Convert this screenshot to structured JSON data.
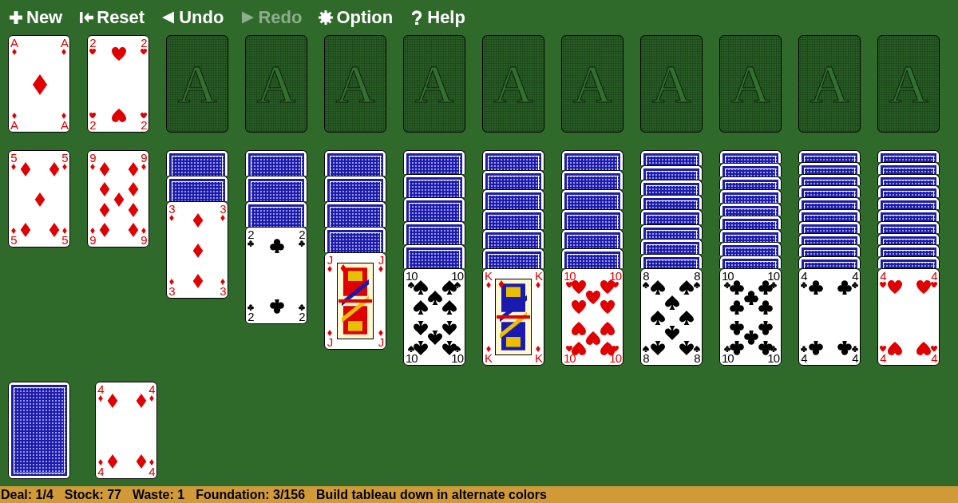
{
  "toolbar": [
    {
      "kind": "new",
      "label": "New",
      "disabled": false
    },
    {
      "kind": "reset",
      "label": "Reset",
      "disabled": false
    },
    {
      "kind": "undo",
      "label": "Undo",
      "disabled": false
    },
    {
      "kind": "redo",
      "label": "Redo",
      "disabled": true
    },
    {
      "kind": "option",
      "label": "Option",
      "disabled": false
    },
    {
      "kind": "help",
      "label": "Help",
      "disabled": false
    }
  ],
  "foundations": [
    {
      "kind": "card",
      "suit": {
        "kind": "diamonds"
      },
      "pips": {
        "kind": "ace"
      },
      "indices": [
        "A",
        "A",
        "A",
        "A"
      ]
    },
    {
      "kind": "card",
      "suit": {
        "kind": "hearts"
      },
      "pips": {
        "kind": "two"
      },
      "indices": [
        "2",
        "2",
        "2",
        "2"
      ]
    },
    {
      "kind": "empty",
      "label": "A"
    },
    {
      "kind": "empty",
      "label": "A"
    },
    {
      "kind": "empty",
      "label": "A"
    },
    {
      "kind": "empty",
      "label": "A"
    },
    {
      "kind": "empty",
      "label": "A"
    },
    {
      "kind": "empty",
      "label": "A"
    },
    {
      "kind": "empty",
      "label": "A"
    },
    {
      "kind": "empty",
      "label": "A"
    },
    {
      "kind": "empty",
      "label": "A"
    },
    {
      "kind": "empty",
      "label": "A"
    }
  ],
  "tableau": [
    {
      "cards": [
        {
          "face_up": true,
          "suit": {
            "kind": "diamonds"
          },
          "pips": {
            "kind": "five"
          },
          "indices": [
            "5",
            "5",
            "5",
            "5"
          ]
        }
      ]
    },
    {
      "cards": [
        {
          "face_up": true,
          "suit": {
            "kind": "diamonds"
          },
          "pips": {
            "kind": "nine"
          },
          "indices": [
            "9",
            "9",
            "9",
            "9"
          ]
        }
      ]
    },
    {
      "cards": [
        {
          "face_up": false
        },
        {
          "face_up": false
        },
        {
          "face_up": true,
          "suit": {
            "kind": "diamonds"
          },
          "pips": {
            "kind": "three"
          },
          "indices": [
            "3",
            "3",
            "3",
            "3"
          ]
        }
      ]
    },
    {
      "cards": [
        {
          "face_up": false
        },
        {
          "face_up": false
        },
        {
          "face_up": false
        },
        {
          "face_up": true,
          "suit": {
            "kind": "clubs"
          },
          "pips": {
            "kind": "two"
          },
          "indices": [
            "2",
            "2",
            "2",
            "2"
          ]
        }
      ]
    },
    {
      "cards": [
        {
          "face_up": false
        },
        {
          "face_up": false
        },
        {
          "face_up": false
        },
        {
          "face_up": false
        },
        {
          "face_up": true,
          "suit": {
            "kind": "diamonds"
          },
          "pips": {
            "kind": "jack"
          },
          "indices": [
            "J",
            "J",
            "J",
            "J"
          ]
        }
      ]
    },
    {
      "cards": [
        {
          "face_up": false
        },
        {
          "face_up": false
        },
        {
          "face_up": false
        },
        {
          "face_up": false
        },
        {
          "face_up": false
        },
        {
          "face_up": true,
          "suit": {
            "kind": "spades"
          },
          "pips": {
            "kind": "ten"
          },
          "indices": [
            "10",
            "10",
            "10",
            "10"
          ]
        }
      ]
    },
    {
      "cards": [
        {
          "face_up": false
        },
        {
          "face_up": false
        },
        {
          "face_up": false
        },
        {
          "face_up": false
        },
        {
          "face_up": false
        },
        {
          "face_up": false
        },
        {
          "face_up": true,
          "suit": {
            "kind": "diamonds"
          },
          "pips": {
            "kind": "king"
          },
          "indices": [
            "K",
            "K",
            "K",
            "K"
          ]
        }
      ]
    },
    {
      "cards": [
        {
          "face_up": false
        },
        {
          "face_up": false
        },
        {
          "face_up": false
        },
        {
          "face_up": false
        },
        {
          "face_up": false
        },
        {
          "face_up": false
        },
        {
          "face_up": true,
          "suit": {
            "kind": "hearts"
          },
          "pips": {
            "kind": "ten"
          },
          "indices": [
            "10",
            "10",
            "10",
            "10"
          ]
        }
      ]
    },
    {
      "cards": [
        {
          "face_up": false
        },
        {
          "face_up": false
        },
        {
          "face_up": false
        },
        {
          "face_up": false
        },
        {
          "face_up": false
        },
        {
          "face_up": false
        },
        {
          "face_up": false
        },
        {
          "face_up": false
        },
        {
          "face_up": true,
          "suit": {
            "kind": "spades"
          },
          "pips": {
            "kind": "eight"
          },
          "indices": [
            "8",
            "8",
            "8",
            "8"
          ]
        }
      ]
    },
    {
      "cards": [
        {
          "face_up": false
        },
        {
          "face_up": false
        },
        {
          "face_up": false
        },
        {
          "face_up": false
        },
        {
          "face_up": false
        },
        {
          "face_up": false
        },
        {
          "face_up": false
        },
        {
          "face_up": false
        },
        {
          "face_up": false
        },
        {
          "face_up": true,
          "suit": {
            "kind": "clubs"
          },
          "pips": {
            "kind": "ten"
          },
          "indices": [
            "10",
            "10",
            "10",
            "10"
          ]
        }
      ]
    },
    {
      "cards": [
        {
          "face_up": false
        },
        {
          "face_up": false
        },
        {
          "face_up": false
        },
        {
          "face_up": false
        },
        {
          "face_up": false
        },
        {
          "face_up": false
        },
        {
          "face_up": false
        },
        {
          "face_up": false
        },
        {
          "face_up": false
        },
        {
          "face_up": false
        },
        {
          "face_up": true,
          "suit": {
            "kind": "clubs"
          },
          "pips": {
            "kind": "four"
          },
          "indices": [
            "4",
            "4",
            "4",
            "4"
          ]
        }
      ]
    },
    {
      "cards": [
        {
          "face_up": false
        },
        {
          "face_up": false
        },
        {
          "face_up": false
        },
        {
          "face_up": false
        },
        {
          "face_up": false
        },
        {
          "face_up": false
        },
        {
          "face_up": false
        },
        {
          "face_up": false
        },
        {
          "face_up": false
        },
        {
          "face_up": false
        },
        {
          "face_up": true,
          "suit": {
            "kind": "hearts"
          },
          "pips": {
            "kind": "four"
          },
          "indices": [
            "4",
            "4",
            "4",
            "4"
          ]
        }
      ]
    }
  ],
  "stock": {
    "cards": [
      {
        "face_up": false
      }
    ]
  },
  "waste": {
    "cards": [
      {
        "face_up": true,
        "suit": {
          "kind": "diamonds"
        },
        "pips": {
          "kind": "four"
        },
        "indices": [
          "4",
          "4",
          "4",
          "4"
        ]
      }
    ]
  },
  "status_bar": [
    "Deal: 1/4",
    "Stock: 77",
    "Waste: 1",
    "Foundation: 3/156",
    "Build tableau down in alternate colors"
  ]
}
